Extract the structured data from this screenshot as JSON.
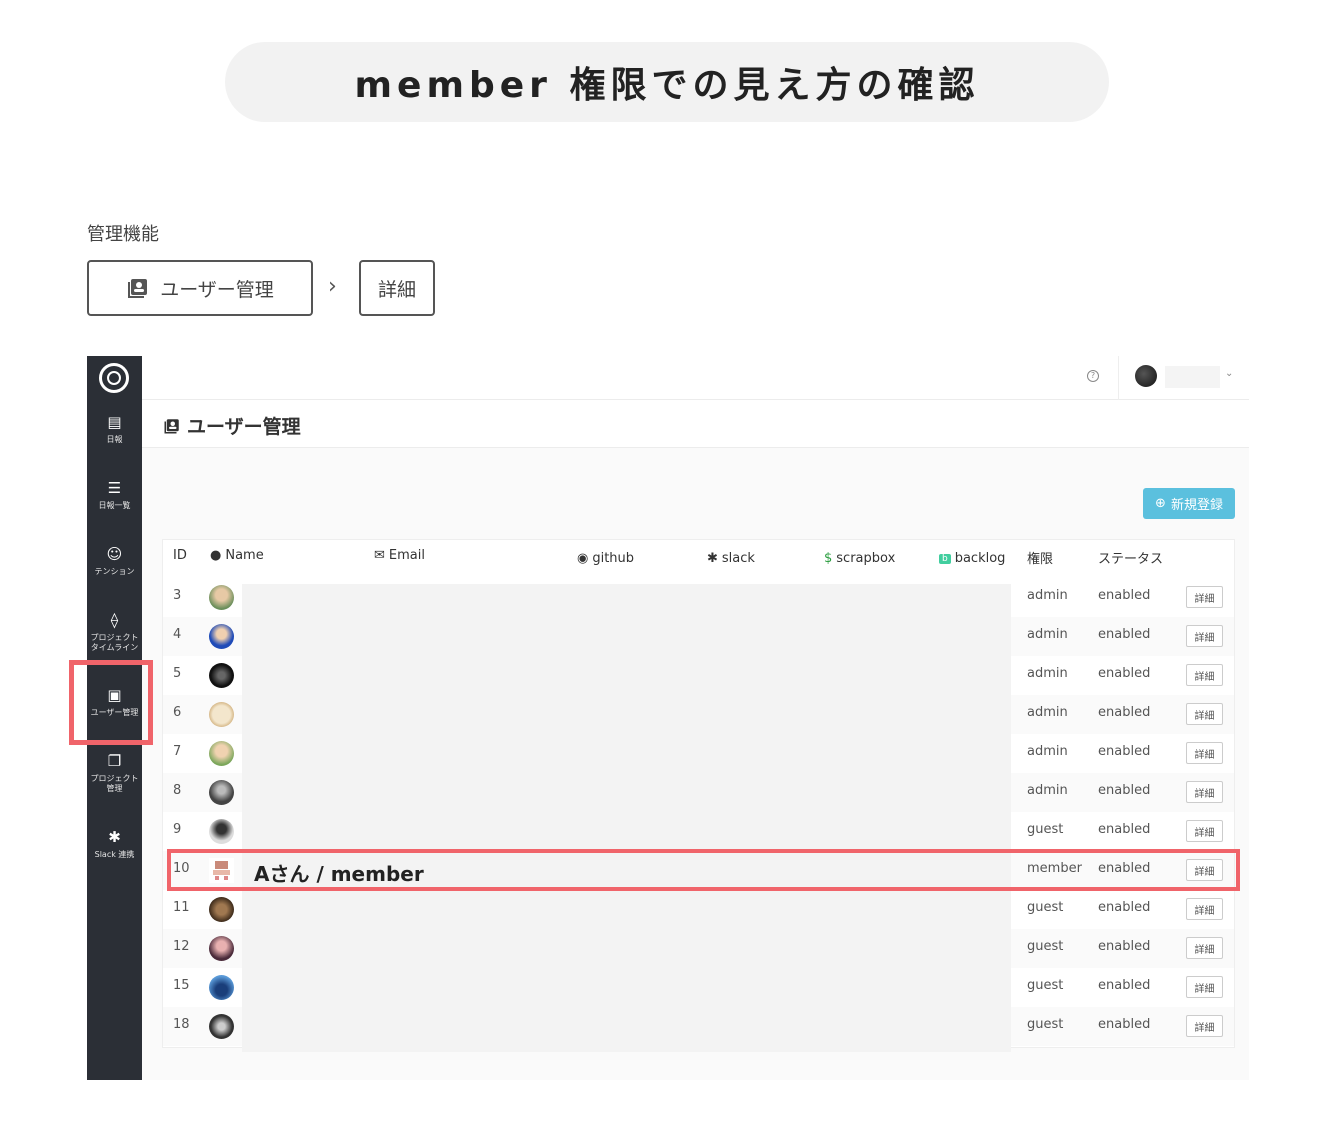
{
  "page": {
    "title": "member 権限での見え方の確認",
    "section_label": "管理機能",
    "breadcrumb": [
      {
        "label": "ユーザー管理",
        "icon": "user-card-icon"
      },
      {
        "label": "詳細"
      }
    ],
    "breadcrumb_separator": "›"
  },
  "sidebar": {
    "items": [
      {
        "label": "日報",
        "icon": "document-icon"
      },
      {
        "label": "日報一覧",
        "icon": "list-icon"
      },
      {
        "label": "テンション",
        "icon": "smile-icon"
      },
      {
        "label": "プロジェクト\nタイムライン",
        "icon": "timeline-icon"
      },
      {
        "label": "ユーザー管理",
        "icon": "user-card-icon"
      },
      {
        "label": "プロジェクト\n管理",
        "icon": "folder-icon"
      },
      {
        "label": "Slack 連携",
        "icon": "slack-icon"
      }
    ]
  },
  "header": {
    "title": "ユーザー管理"
  },
  "actions": {
    "new_button": "新規登録"
  },
  "table": {
    "columns": [
      "ID",
      "Name",
      "Email",
      "github",
      "slack",
      "scrapbox",
      "backlog",
      "権限",
      "ステータス"
    ],
    "detail_label": "詳細",
    "rows": [
      {
        "id": "3",
        "role": "admin",
        "status": "enabled"
      },
      {
        "id": "4",
        "role": "admin",
        "status": "enabled"
      },
      {
        "id": "5",
        "role": "admin",
        "status": "enabled"
      },
      {
        "id": "6",
        "role": "admin",
        "status": "enabled"
      },
      {
        "id": "7",
        "role": "admin",
        "status": "enabled"
      },
      {
        "id": "8",
        "role": "admin",
        "status": "enabled"
      },
      {
        "id": "9",
        "role": "guest",
        "status": "enabled"
      },
      {
        "id": "10",
        "role": "member",
        "status": "enabled"
      },
      {
        "id": "11",
        "role": "guest",
        "status": "enabled"
      },
      {
        "id": "12",
        "role": "guest",
        "status": "enabled"
      },
      {
        "id": "15",
        "role": "guest",
        "status": "enabled"
      },
      {
        "id": "18",
        "role": "guest",
        "status": "enabled"
      }
    ]
  },
  "annotation": {
    "highlighted_row_label": "Aさん / member"
  },
  "colors": {
    "sidebar": "#2b2f36",
    "accent": "#5bc0de",
    "highlight": "#f0646a"
  }
}
